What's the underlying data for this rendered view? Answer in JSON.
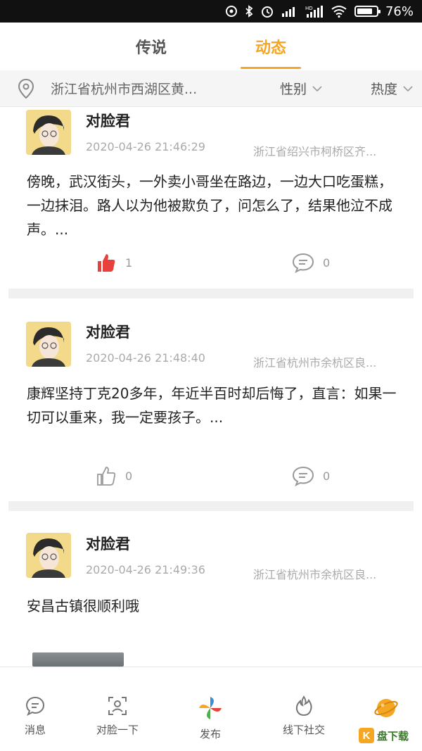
{
  "status_bar": {
    "battery": "76%",
    "battery_level": 0.76
  },
  "tabs": [
    {
      "label": "传说",
      "active": false
    },
    {
      "label": "动态",
      "active": true
    }
  ],
  "filter": {
    "location": "浙江省杭州市西湖区黄...",
    "gender_label": "性别",
    "heat_label": "热度"
  },
  "posts": [
    {
      "author": "对脸君",
      "time": "2020-04-26 21:46:29",
      "location": "浙江省绍兴市柯桥区齐...",
      "content": "傍晚，武汉街头，一外卖小哥坐在路边，一边大口吃蛋糕，一边抹泪。路人以为他被欺负了，问怎么了，结果他泣不成声。...",
      "likes": "1",
      "liked": true,
      "comments": "0"
    },
    {
      "author": "对脸君",
      "time": "2020-04-26 21:48:40",
      "location": "浙江省杭州市余杭区良...",
      "content": "康辉坚持丁克20多年，年近半百时却后悔了，直言：如果一切可以重来，我一定要孩子。...",
      "likes": "0",
      "liked": false,
      "comments": "0"
    },
    {
      "author": "对脸君",
      "time": "2020-04-26 21:49:36",
      "location": "浙江省杭州市余杭区良...",
      "content": "安昌古镇很顺利哦"
    }
  ],
  "bottom_nav": [
    {
      "label": "消息",
      "icon": "message-icon"
    },
    {
      "label": "对脸一下",
      "icon": "face-scan-icon"
    },
    {
      "label": "发布",
      "icon": "pinwheel-icon"
    },
    {
      "label": "线下社交",
      "icon": "flame-icon"
    },
    {
      "label": "",
      "icon": "planet-icon"
    }
  ],
  "watermark": {
    "text": "盘下载"
  },
  "colors": {
    "accent": "#f5a623",
    "like_red": "#e8413c",
    "muted": "#aaaaaa"
  }
}
